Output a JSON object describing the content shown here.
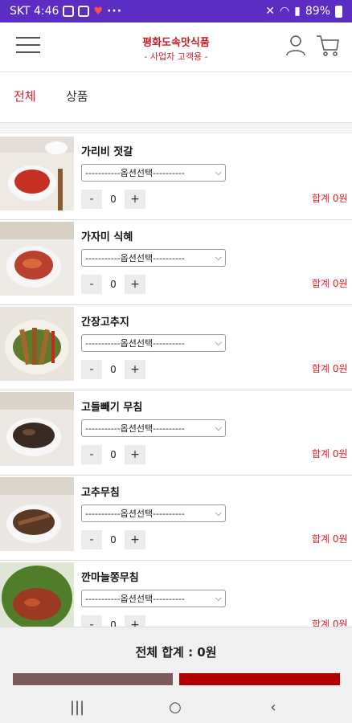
{
  "status_bar": {
    "carrier_time": "SKT 4:46",
    "battery": "89%"
  },
  "header": {
    "brand_name": "평화도속맛식품",
    "brand_sub": "- 사업자 고객용 -"
  },
  "tabs": [
    {
      "label": "전체",
      "active": true
    },
    {
      "label": "상품",
      "active": false
    }
  ],
  "products": [
    {
      "name": "가리비 젓갈",
      "option": "-----------옵션선택----------",
      "qty": "0",
      "total": "합계 0원"
    },
    {
      "name": "가자미 식혜",
      "option": "-----------옵션선택----------",
      "qty": "0",
      "total": "합계 0원"
    },
    {
      "name": "간장고추지",
      "option": "-----------옵션선택----------",
      "qty": "0",
      "total": "합계 0원"
    },
    {
      "name": "고들빼기 무침",
      "option": "-----------옵션선택----------",
      "qty": "0",
      "total": "합계 0원"
    },
    {
      "name": "고추무침",
      "option": "-----------옵션선택----------",
      "qty": "0",
      "total": "합계 0원"
    },
    {
      "name": "깐마늘쫑무침",
      "option": "-----------옵션선택----------",
      "qty": "0",
      "total": "합계 0원"
    }
  ],
  "qty_controls": {
    "minus": "-",
    "plus": "+"
  },
  "footer": {
    "grand_total": "전체 합계 : 0원"
  },
  "colors": {
    "status_bar": "#5b2dc2",
    "accent_red": "#e21c23",
    "bar_left": "#7b5a5a",
    "bar_right": "#b00000"
  }
}
